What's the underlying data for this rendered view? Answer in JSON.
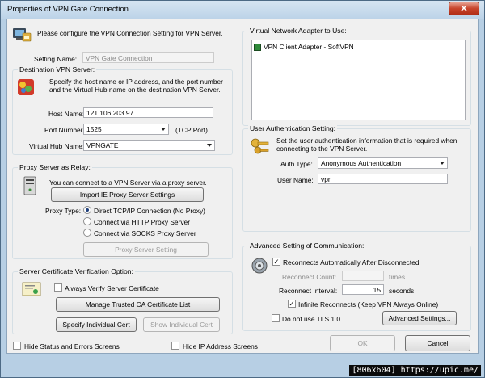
{
  "window": {
    "title": "Properties of VPN Gate Connection",
    "close_label": "✕"
  },
  "header": {
    "intro": "Please configure the VPN Connection Setting for VPN Server."
  },
  "setting_name": {
    "label": "Setting Name:",
    "value": "VPN Gate Connection"
  },
  "destination": {
    "group_title": "Destination VPN Server:",
    "description": "Specify the host name or IP address, and the port number and the Virtual Hub name on the destination VPN Server.",
    "host_label": "Host Name:",
    "host_value": "121.106.203.97",
    "port_label": "Port Number:",
    "port_value": "1525",
    "port_hint": "(TCP Port)",
    "hub_label": "Virtual Hub Name:",
    "hub_value": "VPNGATE"
  },
  "proxy": {
    "group_title": "Proxy Server as Relay:",
    "description": "You can connect to a VPN Server via a proxy server.",
    "import_button": "Import IE Proxy Server Settings",
    "type_label": "Proxy Type:",
    "options": [
      "Direct TCP/IP Connection (No Proxy)",
      "Connect via HTTP Proxy Server",
      "Connect via SOCKS Proxy Server"
    ],
    "selected_index": 0,
    "settings_button": "Proxy Server Setting"
  },
  "certificate": {
    "group_title": "Server Certificate Verification Option:",
    "always_verify_label": "Always Verify Server Certificate",
    "manage_button": "Manage Trusted CA Certificate List",
    "specify_button": "Specify Individual Cert",
    "show_button": "Show Individual Cert"
  },
  "adapter": {
    "group_title": "Virtual Network Adapter to Use:",
    "items": [
      "VPN Client Adapter - SoftVPN"
    ]
  },
  "auth": {
    "group_title": "User Authentication Setting:",
    "description": "Set the user authentication information that is required when connecting to the VPN Server.",
    "type_label": "Auth Type:",
    "type_value": "Anonymous Authentication",
    "user_label": "User Name:",
    "user_value": "vpn"
  },
  "advanced": {
    "group_title": "Advanced Setting of Communication:",
    "reconnect_label": "Reconnects Automatically After Disconnected",
    "reconnect_count_label": "Reconnect Count:",
    "reconnect_count_unit": "times",
    "reconnect_count_value": "",
    "interval_label": "Reconnect Interval:",
    "interval_value": "15",
    "interval_unit": "seconds",
    "infinite_label": "Infinite Reconnects (Keep VPN Always Online)",
    "tls_label": "Do not use TLS 1.0",
    "advanced_button": "Advanced Settings..."
  },
  "footer": {
    "hide_status_label": "Hide Status and Errors Screens",
    "hide_ip_label": "Hide IP Address Screens",
    "ok_button": "OK",
    "cancel_button": "Cancel"
  },
  "watermark": "[806x604] https://upic.me/",
  "colors": {
    "accent": "#1e3f7a",
    "window_frame": "#b7cfe4",
    "close": "#c8442b"
  }
}
